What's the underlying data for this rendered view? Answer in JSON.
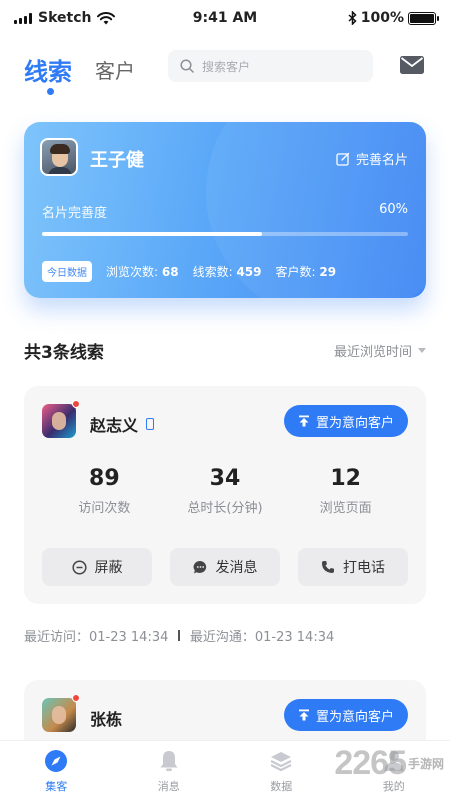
{
  "status_bar": {
    "carrier": "Sketch",
    "time": "9:41 AM",
    "battery": "100%"
  },
  "header": {
    "tabs": [
      {
        "label": "线索"
      },
      {
        "label": "客户"
      }
    ],
    "search_placeholder": "搜索客户"
  },
  "profile_card": {
    "name": "王子健",
    "edit_label": "完善名片",
    "completeness_label": "名片完善度",
    "completeness_value": "60%",
    "completeness_fraction": 0.6,
    "today_badge": "今日数据",
    "stats": [
      {
        "label": "浏览次数:",
        "value": "68"
      },
      {
        "label": "线索数:",
        "value": "459"
      },
      {
        "label": "客户数:",
        "value": "29"
      }
    ]
  },
  "leads_section": {
    "title": "共3条线索",
    "sort_label": "最近浏览时间"
  },
  "leads": [
    {
      "name": "赵志义",
      "intent_button": "置为意向客户",
      "metrics": [
        {
          "value": "89",
          "label": "访问次数"
        },
        {
          "value": "34",
          "label": "总时长(分钟)"
        },
        {
          "value": "12",
          "label": "浏览页面"
        }
      ],
      "actions": [
        {
          "label": "屏蔽",
          "icon": "block-icon"
        },
        {
          "label": "发消息",
          "icon": "message-icon"
        },
        {
          "label": "打电话",
          "icon": "phone-call-icon"
        }
      ],
      "last_visit": "最近访问：01-23 14:34",
      "last_contact": "最近沟通：01-23 14:34"
    },
    {
      "name": "张栋",
      "intent_button": "置为意向客户"
    }
  ],
  "bottom_nav": [
    {
      "label": "集客",
      "icon": "compass-icon",
      "active": true
    },
    {
      "label": "消息",
      "icon": "bell-icon",
      "active": false
    },
    {
      "label": "数据",
      "icon": "layers-icon",
      "active": false
    },
    {
      "label": "我的",
      "icon": "user-icon",
      "active": false
    }
  ],
  "watermark": {
    "brand": "2265",
    "suffix": "手游网"
  },
  "colors": {
    "accent": "#2f7bf5",
    "alert_dot": "#f0463f"
  }
}
